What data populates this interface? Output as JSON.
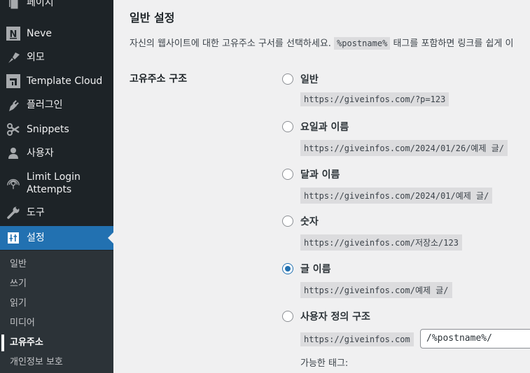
{
  "sidebar": {
    "items": [
      {
        "label": "페이지",
        "icon": "page-icon"
      },
      {
        "label": "Neve",
        "icon": "neve-icon"
      },
      {
        "label": "외모",
        "icon": "paintbrush-icon"
      },
      {
        "label": "Template Cloud",
        "icon": "template-cloud-icon"
      },
      {
        "label": "플러그인",
        "icon": "plugin-icon"
      },
      {
        "label": "Snippets",
        "icon": "scissors-icon"
      },
      {
        "label": "사용자",
        "icon": "user-icon"
      },
      {
        "label": "Limit Login Attempts",
        "label_line1": "Limit Login",
        "label_line2": "Attempts",
        "icon": "fingerprint-icon"
      },
      {
        "label": "도구",
        "icon": "wrench-icon"
      },
      {
        "label": "설정",
        "icon": "settings-icon",
        "current": true
      }
    ],
    "submenu": [
      {
        "label": "일반"
      },
      {
        "label": "쓰기"
      },
      {
        "label": "읽기"
      },
      {
        "label": "미디어"
      },
      {
        "label": "고유주소",
        "active": true
      },
      {
        "label": "개인정보 보호"
      }
    ]
  },
  "main": {
    "section_title": "일반 설정",
    "description_before": "자신의 웹사이트에 대한 고유주소 구서를 선택하세요.",
    "description_code": "%postname%",
    "description_after": "태그를 포함하면 링크를 쉽게 이",
    "row_label": "고유주소 구조",
    "options": [
      {
        "label": "일반",
        "example": "https://giveinfos.com/?p=123",
        "checked": false
      },
      {
        "label": "요일과 이름",
        "example": "https://giveinfos.com/2024/01/26/예제 글/",
        "checked": false
      },
      {
        "label": "달과 이름",
        "example": "https://giveinfos.com/2024/01/예제 글/",
        "checked": false
      },
      {
        "label": "숫자",
        "example": "https://giveinfos.com/저장소/123",
        "checked": false
      },
      {
        "label": "글 이름",
        "example": "https://giveinfos.com/예제 글/",
        "checked": true
      },
      {
        "label": "사용자 정의 구조",
        "example": "https://giveinfos.com",
        "checked": false
      }
    ],
    "custom_structure_value": "/%postname%/",
    "available_tags_label": "가능한 태그:"
  }
}
